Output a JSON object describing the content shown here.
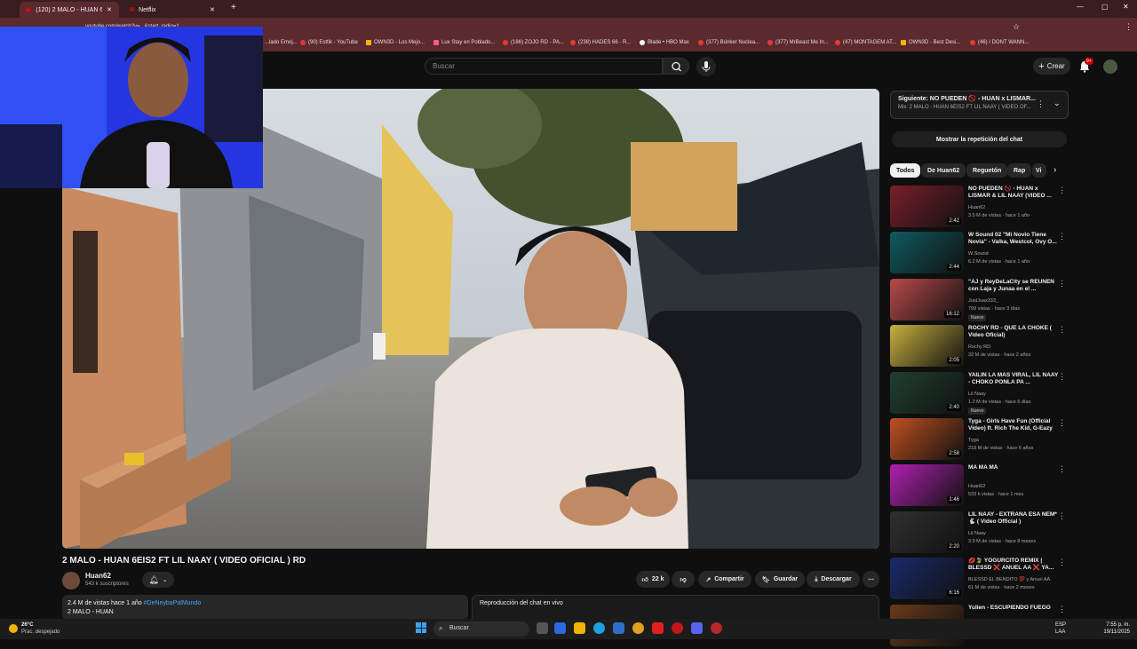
{
  "browser": {
    "tabs": [
      {
        "label": "(120) 2 MALO - HUAN 6EIS",
        "active": true
      },
      {
        "label": "Netflix",
        "active": false
      }
    ],
    "url": "youtube.com/watch?v=...&start_radio=1",
    "bookmarks": [
      "...lado Emoj...",
      "(90) Esttik - YouTube",
      "OWN3D - Los Mejo...",
      "Lux Stay en Poblado...",
      "(186) ZOJO RD - PA...",
      "(238) HADES 66 - R...",
      "Blade • HBO Max",
      "(377) Búnker Nuclea...",
      "(377) MrBeast Me In...",
      "(47) MONTAGEM AT...",
      "OWN3D - Best Desi...",
      "(46) I DONT WANN..."
    ]
  },
  "header": {
    "search_placeholder": "Buscar",
    "create_label": "Crear",
    "notif_count": "9+"
  },
  "video": {
    "title": "2 MALO - HUAN 6EIS2 FT LIL NAAY ( VIDEO OFICIAL ) RD",
    "channel": "Huan62",
    "subscribers": "543 k suscriptores",
    "likes": "22 k",
    "share_label": "Compartir",
    "save_label": "Guardar",
    "download_label": "Descargar",
    "views_date": "2.4 M de vistas  hace 1 año",
    "hashtag": "#DeNeybaPalMundo",
    "desc_line2": "2 MALO - HUAN",
    "chat_replay_title": "Reproducción del chat en vivo"
  },
  "sidebar": {
    "next_title": "Siguiente: NO PUEDEN 🚫 - HUAN x LISMAR...",
    "next_sub": "Mix: 2 MALO - HUAN 6EIS2 FT LIL NAAY ( VIDEO OF...",
    "replay_button": "Mostrar la repetición del chat",
    "chips": [
      "Todos",
      "De Huan62",
      "Reguetón",
      "Rap",
      "Vi"
    ],
    "recs": [
      {
        "title": "NO PUEDEN 🚫 - HUAN x LISMAR & LIL NAAY (VIDEO ...",
        "channel": "Huan62",
        "meta": "3.5 M de vistas · hace 1 año",
        "duration": "2:42",
        "nuevo": ""
      },
      {
        "title": "W Sound 02 \"Mi Novio Tiene Novia\" - Valka, Westcol, Ovy O...",
        "channel": "W Sound",
        "meta": "6.2 M de vistas · hace 1 año",
        "duration": "2:44",
        "nuevo": ""
      },
      {
        "title": "\"AJ y ReyDeLaCity se REUNEN con Laja y Junaa en el ...",
        "channel": "JustJuax333_",
        "meta": "799 vistas · hace 3 días",
        "duration": "16:12",
        "nuevo": "Nuevo"
      },
      {
        "title": "ROCHY RD - QUE LA CHOKE ( Video Oficial)",
        "channel": "Rochy RD",
        "meta": "32 M de vistas · hace 2 años",
        "duration": "2:05",
        "nuevo": ""
      },
      {
        "title": "YAILIN LA MÁS VIRAL, LIL NAAY - CHOKO PONLA PA ...",
        "channel": "Lil Naay",
        "meta": "1.2 M de vistas · hace 6 días",
        "duration": "2:40",
        "nuevo": "Nuevo"
      },
      {
        "title": "Tyga - Girls Have Fun (Official Video) ft. Rich The Kid, G-Eazy",
        "channel": "Tyga",
        "meta": "218 M de vistas · hace 6 años",
        "duration": "2:58",
        "nuevo": ""
      },
      {
        "title": "MA MA MÁ",
        "channel": "Huan62",
        "meta": "533 k vistas · hace 1 mes",
        "duration": "1:46",
        "nuevo": ""
      },
      {
        "title": "LIL NAAY - EXTRAÑA ESA NEM* 🐇 ( Video Official )",
        "channel": "Lil Naay",
        "meta": "3.9 M de vistas · hace 8 meses",
        "duration": "2:20",
        "nuevo": ""
      },
      {
        "title": "💋🍃 YOGURCITO REMIX | BLESSD ❌ ANUEL AA ❌ YA...",
        "channel": "BLESSD EL BENDITO 💯 y Anuel AA",
        "meta": "61 M de vistas · hace 2 meses",
        "duration": "6:16",
        "nuevo": ""
      },
      {
        "title": "Yulien - ESCUPIENDO FUEGO",
        "channel": "Yulien",
        "meta": "",
        "duration": "",
        "nuevo": ""
      }
    ]
  },
  "taskbar": {
    "temp": "26°C",
    "weather": "Prac. despejado",
    "search": "Buscar",
    "lang1": "ESP",
    "lang2": "LAA",
    "time": "7:55 p. m.",
    "date": "19/11/2025"
  }
}
